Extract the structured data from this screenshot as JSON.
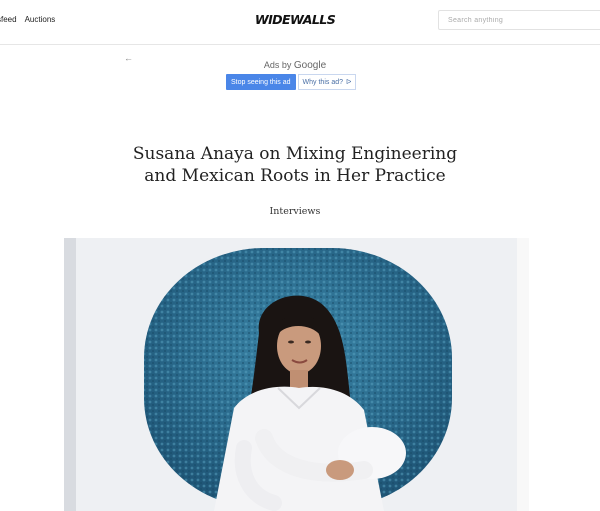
{
  "nav": {
    "items": [
      "sfeed",
      "Auctions"
    ]
  },
  "logo": {
    "text": "WIDEWALLS"
  },
  "search": {
    "placeholder": "Search anything"
  },
  "ad": {
    "back_icon": "←",
    "ads_by": "Ads by",
    "google": "Google",
    "stop_label": "Stop seeing this ad",
    "why_label": "Why this ad?",
    "why_icon": "ᐅ"
  },
  "article": {
    "title_line1": "Susana Anaya on Mixing Engineering",
    "title_line2": "and Mexican Roots in Her Practice",
    "category": "Interviews"
  },
  "colors": {
    "ad_blue": "#4a86e8",
    "artwork_blue": "#2d6e8e"
  }
}
